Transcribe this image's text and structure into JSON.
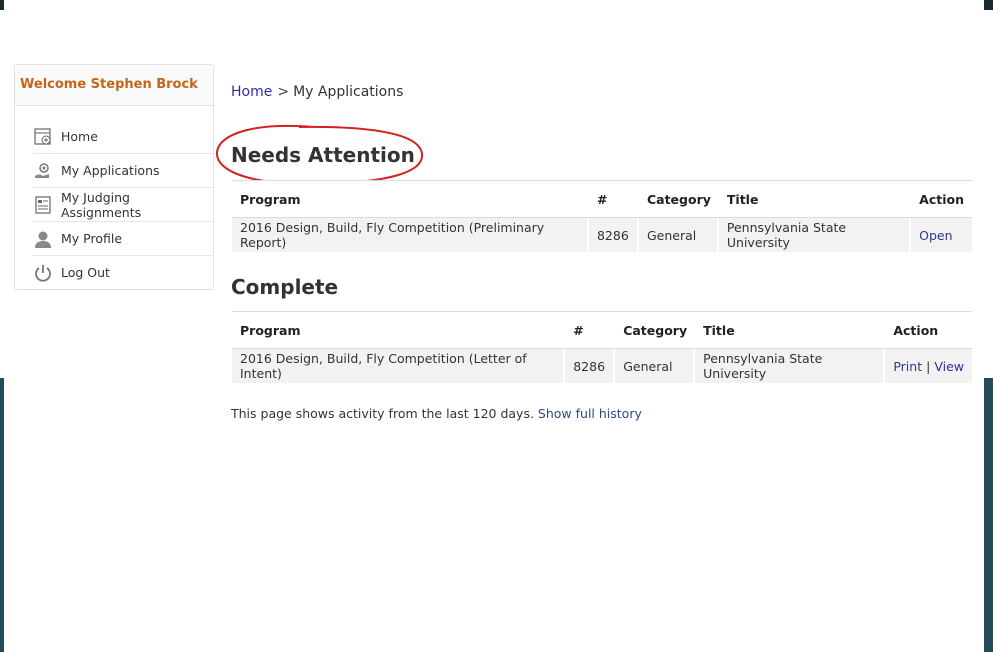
{
  "sidebar": {
    "welcome": "Welcome Stephen Brock",
    "items": [
      {
        "label": "Home",
        "icon": "home-icon"
      },
      {
        "label": "My Applications",
        "icon": "applications-icon"
      },
      {
        "label": "My Judging Assignments",
        "icon": "judging-icon"
      },
      {
        "label": "My Profile",
        "icon": "profile-icon"
      },
      {
        "label": "Log Out",
        "icon": "power-icon"
      }
    ]
  },
  "breadcrumb": {
    "home": "Home",
    "separator": ">",
    "current": "My Applications"
  },
  "needs_attention": {
    "title": "Needs Attention",
    "headers": [
      "Program",
      "#",
      "Category",
      "Title",
      "Action"
    ],
    "rows": [
      {
        "program": "2016 Design, Build, Fly Competition (Preliminary Report)",
        "number": "8286",
        "category": "General",
        "title": "Pennsylvania State University",
        "action": "Open"
      }
    ]
  },
  "complete": {
    "title": "Complete",
    "headers": [
      "Program",
      "#",
      "Category",
      "Title",
      "Action"
    ],
    "rows": [
      {
        "program": "2016 Design, Build, Fly Competition (Letter of Intent)",
        "number": "8286",
        "category": "General",
        "title": "Pennsylvania State University",
        "action_print": "Print",
        "action_separator": "|",
        "action_view": "View"
      }
    ]
  },
  "footer": {
    "note": "This page shows activity from the last 120 days.",
    "link": "Show full history"
  },
  "colors": {
    "welcome": "#c5641a",
    "link": "#2d2ea8",
    "annotation": "#d42020",
    "background_band": "#244c5a"
  }
}
